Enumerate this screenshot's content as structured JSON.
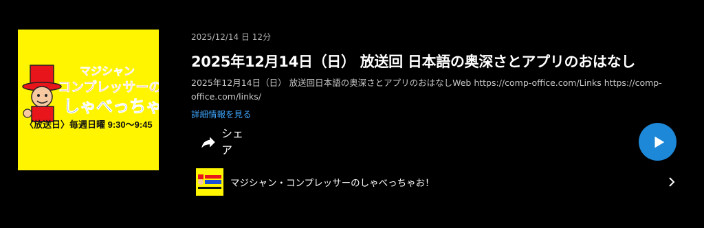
{
  "episode": {
    "meta": "2025/12/14 日  12分",
    "title": "2025年12月14日（日） 放送回 日本語の奥深さとアプリのおはなし",
    "description": "2025年12月14日（日） 放送回日本語の奥深さとアプリのおはなしWeb https://comp-office.com/Links https://comp-office.com/links/",
    "more_label": "詳細情報を見る",
    "share_label": "シェア"
  },
  "cover": {
    "logo_line1": "マジシャン",
    "logo_line2": "コンプレッサーの",
    "logo_line3": "しゃべっちゃお",
    "schedule": "〈放送日〉毎週日曜 9:30～9:45"
  },
  "show": {
    "name": "マジシャン・コンプレッサーのしゃべっちゃお！"
  },
  "colors": {
    "background": "#000000",
    "accent": "#1e88d8",
    "link": "#3ea6ff",
    "cover_bg": "#fff500"
  },
  "icons": {
    "share": "share-arrow-icon",
    "play": "play-icon",
    "chevron": "chevron-right-icon"
  }
}
